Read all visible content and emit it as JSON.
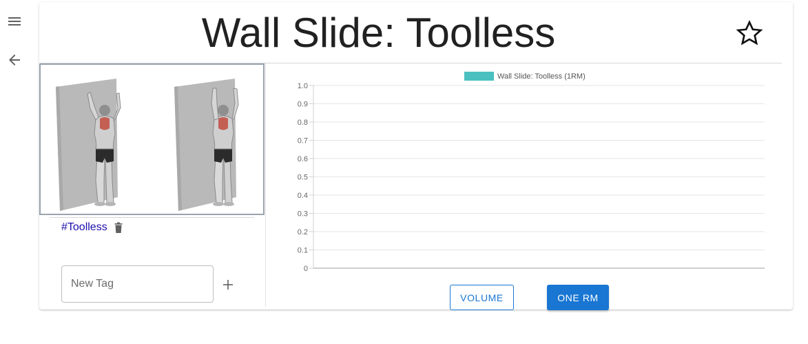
{
  "nav": {
    "menu_icon": "hamburger-menu-icon",
    "back_icon": "arrow-back-icon"
  },
  "exercise": {
    "title": "Wall Slide: Toolless",
    "favorite_icon": "star-outline-icon",
    "favorited": false
  },
  "tags": {
    "items": [
      {
        "label": "#Toolless",
        "delete_icon": "trash-icon"
      }
    ],
    "new_tag_placeholder": "New Tag",
    "new_tag_value": "",
    "add_icon": "plus-icon"
  },
  "chart_data": {
    "type": "bar",
    "series": [
      {
        "name": "Wall Slide: Toolless (1RM)",
        "values": [],
        "color": "#4bc0c0"
      }
    ],
    "categories": [],
    "ylim": [
      0,
      1.0
    ],
    "yticks": [
      "0",
      "0.1",
      "0.2",
      "0.3",
      "0.4",
      "0.5",
      "0.6",
      "0.7",
      "0.8",
      "0.9",
      "1.0"
    ],
    "grid": true,
    "legend_position": "top"
  },
  "chart_toggle": {
    "volume_label": "VOLUME",
    "one_rm_label": "ONE RM",
    "selected": "ONE RM"
  },
  "colors": {
    "primary": "#1976d2",
    "series": "#4bc0c0",
    "tag_link": "#1a0dab"
  }
}
